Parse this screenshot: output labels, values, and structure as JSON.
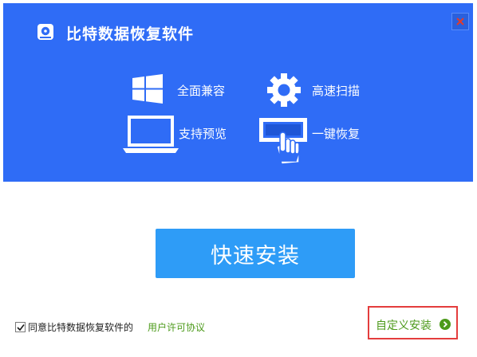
{
  "app": {
    "title": "比特数据恢复软件"
  },
  "features": [
    {
      "label": "全面兼容",
      "icon": "windows-icon"
    },
    {
      "label": "高速扫描",
      "icon": "gear-icon"
    },
    {
      "label": "支持预览",
      "icon": "laptop-icon"
    },
    {
      "label": "一键恢复",
      "icon": "hand-click-icon"
    }
  ],
  "install": {
    "quick_label": "快速安装",
    "custom_label": "自定义安装"
  },
  "agreement": {
    "checked": true,
    "text": "同意比特数据恢复软件的",
    "link": "用户许可协议"
  },
  "colors": {
    "header_blue": "#2f6cf6",
    "button_blue": "#2e9cf7",
    "link_green": "#4c9a1a",
    "highlight_red": "#e43d3d"
  }
}
